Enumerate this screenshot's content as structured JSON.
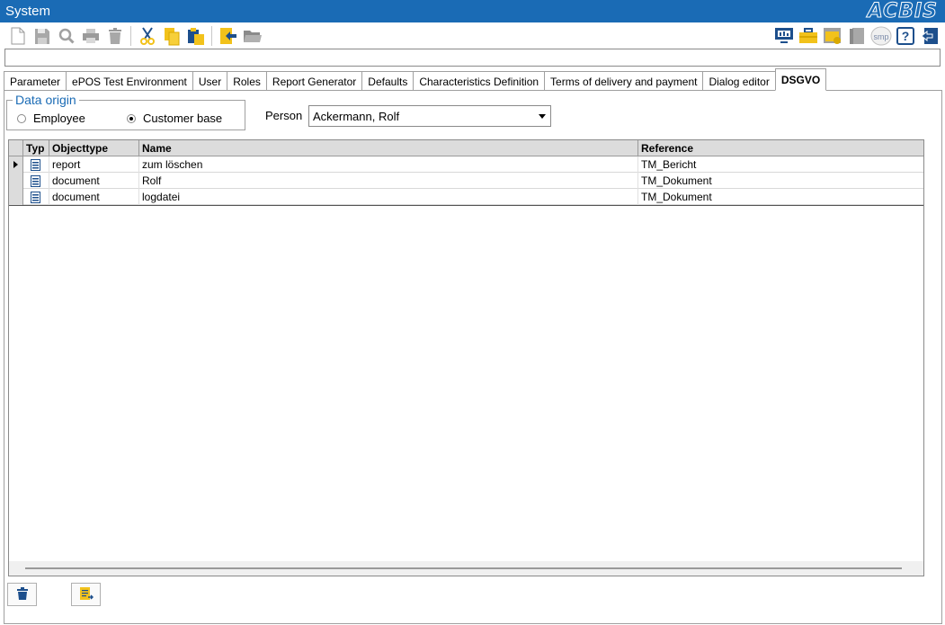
{
  "window": {
    "title": "System",
    "brand": "ACBIS"
  },
  "toolbar": {
    "left_icons": [
      "new-document-icon",
      "save-icon",
      "search-icon",
      "print-icon",
      "delete-icon",
      "cut-icon",
      "copy-icon",
      "paste-icon",
      "export-icon",
      "open-folder-icon"
    ],
    "right_icons": [
      "monitor-icon",
      "briefcase-icon",
      "window-settings-icon",
      "book-icon",
      "smp-icon",
      "help-icon",
      "exit-icon"
    ],
    "smp_label": "smp",
    "help_label": "?"
  },
  "command_line": {
    "value": ""
  },
  "tabs": [
    "Parameter",
    "ePOS Test Environment",
    "User",
    "Roles",
    "Report Generator",
    "Defaults",
    "Characteristics Definition",
    "Terms of delivery and payment",
    "Dialog editor",
    "DSGVO"
  ],
  "active_tab": "DSGVO",
  "data_origin": {
    "legend": "Data origin",
    "options": [
      "Employee",
      "Customer base"
    ],
    "selected": "Customer base"
  },
  "person": {
    "label": "Person",
    "value": "Ackermann, Rolf"
  },
  "grid": {
    "columns": [
      "Typ",
      "Objecttype",
      "Name",
      "Reference"
    ],
    "rows": [
      {
        "objecttype": "report",
        "name": "zum löschen",
        "reference": "TM_Bericht"
      },
      {
        "objecttype": "document",
        "name": "Rolf",
        "reference": "TM_Dokument"
      },
      {
        "objecttype": "document",
        "name": "logdatei",
        "reference": "TM_Dokument"
      }
    ],
    "current_row": 0
  },
  "bottom_buttons": [
    "trash-icon",
    "document-export-icon"
  ],
  "colors": {
    "accent": "#1a6bb5",
    "icon_yellow": "#f2c21b",
    "icon_dark": "#1d4f8c"
  }
}
